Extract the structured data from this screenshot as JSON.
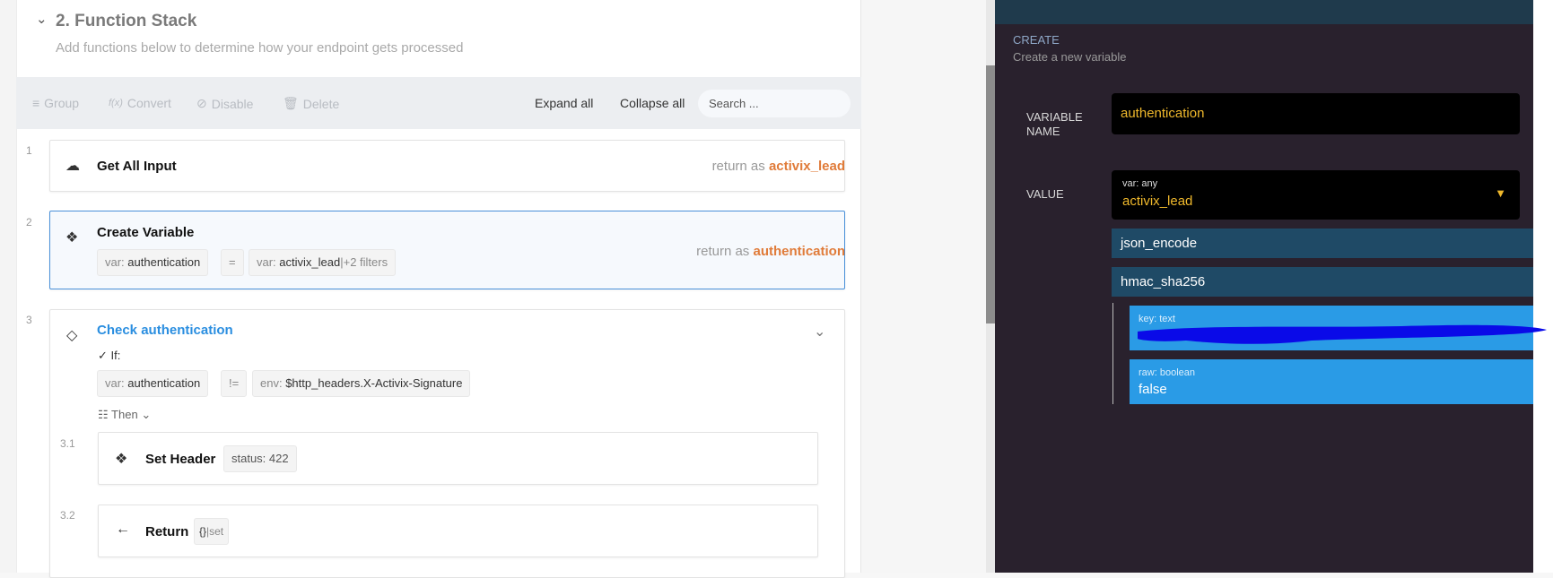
{
  "section": {
    "title": "2. Function Stack",
    "subtitle": "Add functions below to determine how your endpoint gets processed"
  },
  "toolbar": {
    "group": "Group",
    "convert": "Convert",
    "convert_icon": "f(x)",
    "disable": "Disable",
    "delete": "Delete",
    "expand_all": "Expand all",
    "collapse_all": "Collapse all",
    "search_placeholder": "Search ..."
  },
  "steps": [
    {
      "num": "1",
      "title": "Get All Input",
      "return_prefix": "return as",
      "return_var": "activix_lead"
    },
    {
      "num": "2",
      "title": "Create Variable",
      "chip1_prefix": "var:",
      "chip1_value": "authentication",
      "op": "=",
      "chip2_prefix": "var:",
      "chip2_value": "activix_lead",
      "chip2_suffix": "|+2 filters",
      "return_prefix": "return as",
      "return_var": "authentication"
    },
    {
      "num": "3",
      "title": "Check authentication",
      "if_label": "If:",
      "chip1_prefix": "var:",
      "chip1_value": "authentication",
      "op": "!=",
      "chip2_prefix": "env:",
      "chip2_value": "$http_headers.X-Activix-Signature",
      "then_label": "Then",
      "children": [
        {
          "num": "3.1",
          "title": "Set Header",
          "chip": "status: 422"
        },
        {
          "num": "3.2",
          "title": "Return",
          "chip_a": "{}",
          "chip_b": "|set"
        }
      ]
    }
  ],
  "panel": {
    "heading": "CREATE",
    "subheading": "Create a new variable",
    "name_label_1": "VARIABLE",
    "name_label_2": "NAME",
    "name_value": "authentication",
    "value_label": "VALUE",
    "value_type": "var: any",
    "value_value": "activix_lead",
    "filters": [
      "json_encode",
      "hmac_sha256"
    ],
    "params": [
      {
        "type": "key: text"
      },
      {
        "type": "raw: boolean",
        "value": "false"
      }
    ]
  },
  "colors": {
    "accent_orange": "#e07b39",
    "accent_blue": "#2a8ee0",
    "panel_bg": "#29212d",
    "yellow": "#f0b92c"
  }
}
